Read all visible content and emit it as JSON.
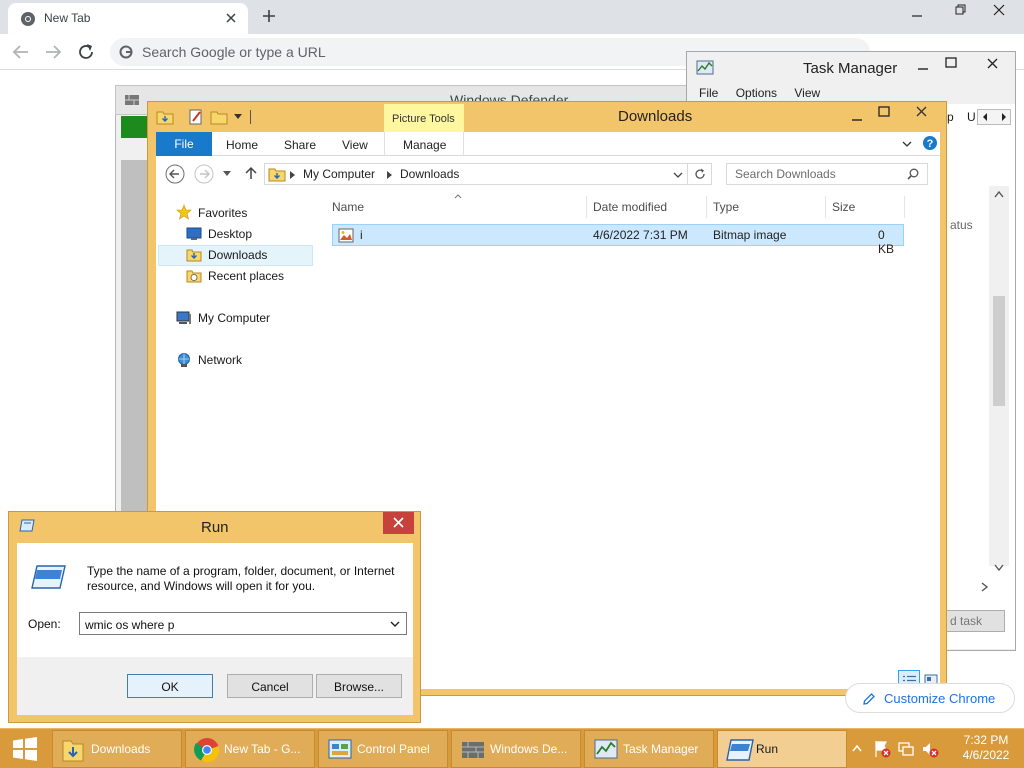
{
  "chrome": {
    "tab_title": "New Tab",
    "omnibox_placeholder": "Search Google or type a URL",
    "customize_label": "Customize Chrome"
  },
  "defender": {
    "title": "Windows Defender"
  },
  "task_manager": {
    "title": "Task Manager",
    "menu": [
      "File",
      "Options",
      "View"
    ],
    "status_col": "atus",
    "tab_fragment_a": "p",
    "tab_fragment_b": "U",
    "end_task": "d task"
  },
  "explorer": {
    "title": "Downloads",
    "context_tab_group": "Picture Tools",
    "ribbon_tabs": {
      "file": "File",
      "home": "Home",
      "share": "Share",
      "view": "View",
      "manage": "Manage"
    },
    "breadcrumb": [
      "My Computer",
      "Downloads"
    ],
    "search_placeholder": "Search Downloads",
    "nav": {
      "favorites": "Favorites",
      "desktop": "Desktop",
      "downloads": "Downloads",
      "recent": "Recent places",
      "computer": "My Computer",
      "network": "Network"
    },
    "columns": {
      "name": "Name",
      "date": "Date modified",
      "type": "Type",
      "size": "Size"
    },
    "files": [
      {
        "name": "i",
        "date": "4/6/2022 7:31 PM",
        "type": "Bitmap image",
        "size": "0 KB"
      }
    ]
  },
  "run": {
    "title": "Run",
    "description": "Type the name of a program, folder, document, or Internet resource, and Windows will open it for you.",
    "open_label": "Open:",
    "input_value": "wmic os where p",
    "ok": "OK",
    "cancel": "Cancel",
    "browse": "Browse..."
  },
  "taskbar": {
    "items": [
      "Downloads",
      "New Tab - G...",
      "Control Panel",
      "Windows De...",
      "Task Manager",
      "Run"
    ],
    "time": "7:32 PM",
    "date": "4/6/2022"
  },
  "colors": {
    "window_frame": "#f2c56b",
    "taskbar": "#d89a3a",
    "file_tab": "#1979ca",
    "selection": "#cce8ff",
    "close_red": "#c7423a"
  }
}
